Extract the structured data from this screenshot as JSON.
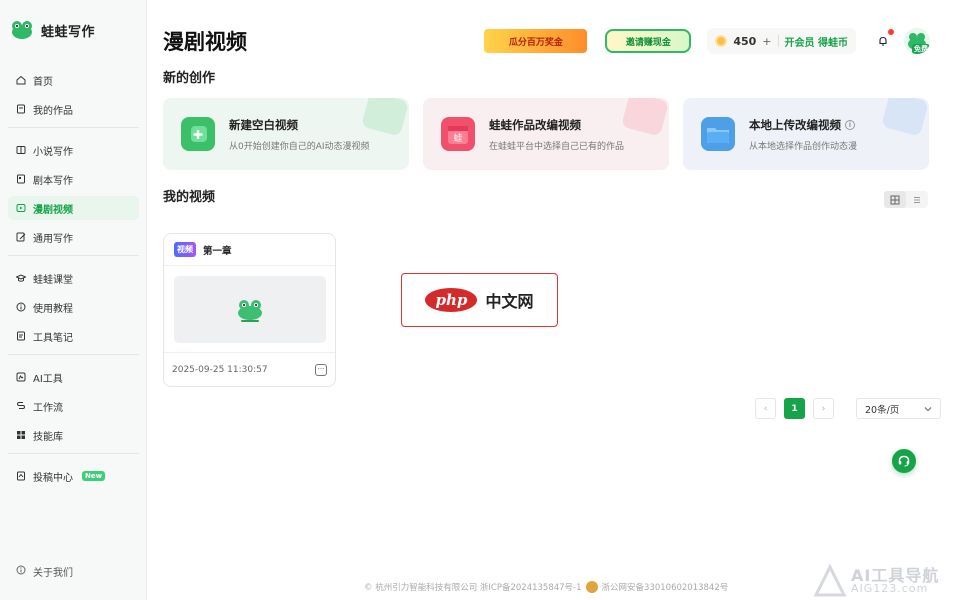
{
  "app": {
    "name": "蛙蛙写作"
  },
  "sidebar": {
    "groups": [
      [
        {
          "label": "首页",
          "icon": "home-icon"
        },
        {
          "label": "我的作品",
          "icon": "works-icon"
        }
      ],
      [
        {
          "label": "小说写作",
          "icon": "book-icon"
        },
        {
          "label": "剧本写作",
          "icon": "script-icon"
        },
        {
          "label": "漫剧视频",
          "icon": "video-icon",
          "active": true
        },
        {
          "label": "通用写作",
          "icon": "edit-icon"
        }
      ],
      [
        {
          "label": "蛙蛙课堂",
          "icon": "graduation-cap-icon"
        },
        {
          "label": "使用教程",
          "icon": "info-icon"
        },
        {
          "label": "工具笔记",
          "icon": "note-icon"
        }
      ],
      [
        {
          "label": "AI工具",
          "icon": "ai-tool-icon"
        },
        {
          "label": "工作流",
          "icon": "workflow-icon"
        },
        {
          "label": "技能库",
          "icon": "grid-icon"
        }
      ],
      [
        {
          "label": "投稿中心",
          "icon": "submit-icon",
          "badge": "New"
        }
      ]
    ],
    "about": "关于我们"
  },
  "header": {
    "title": "漫剧视频",
    "banner1": "瓜分百万奖金",
    "banner2": "邀请赚现金",
    "coins": "450",
    "coins_plus": "+",
    "vip_label": "开会员 得蛙币",
    "avatar_badge": "免费"
  },
  "new_creation": {
    "title": "新的创作",
    "cards": [
      {
        "title": "新建空白视频",
        "subtitle": "从0开始创建你自己的AI动态漫视频",
        "theme": "green",
        "accent": "#3dbf6a"
      },
      {
        "title": "蛙蛙作品改编视频",
        "subtitle": "在蛙蛙平台中选择自己已有的作品",
        "theme": "pink",
        "accent": "#f0506b"
      },
      {
        "title": "本地上传改编视频",
        "subtitle": "从本地选择作品创作动态漫",
        "theme": "blue",
        "accent": "#4d9fe8",
        "info": "i"
      }
    ]
  },
  "my_videos": {
    "title": "我的视频",
    "items": [
      {
        "tag": "视频",
        "title": "第一章",
        "date": "2025-09-25 11:30:57"
      }
    ]
  },
  "watermark": {
    "logo": "php",
    "text": "中文网"
  },
  "pagination": {
    "prev": "‹",
    "current": "1",
    "next": "›",
    "page_size": "20条/页"
  },
  "footer": {
    "company": "© 杭州引力智能科技有限公司 浙ICP备2024135847号-1",
    "police": "浙公网安备33010602013842号"
  },
  "corner_watermark": {
    "top": "AI工具导航",
    "bottom": "AIG123.com"
  },
  "colors": {
    "brand": "#16a34a",
    "accent_red": "#ff3b30"
  }
}
